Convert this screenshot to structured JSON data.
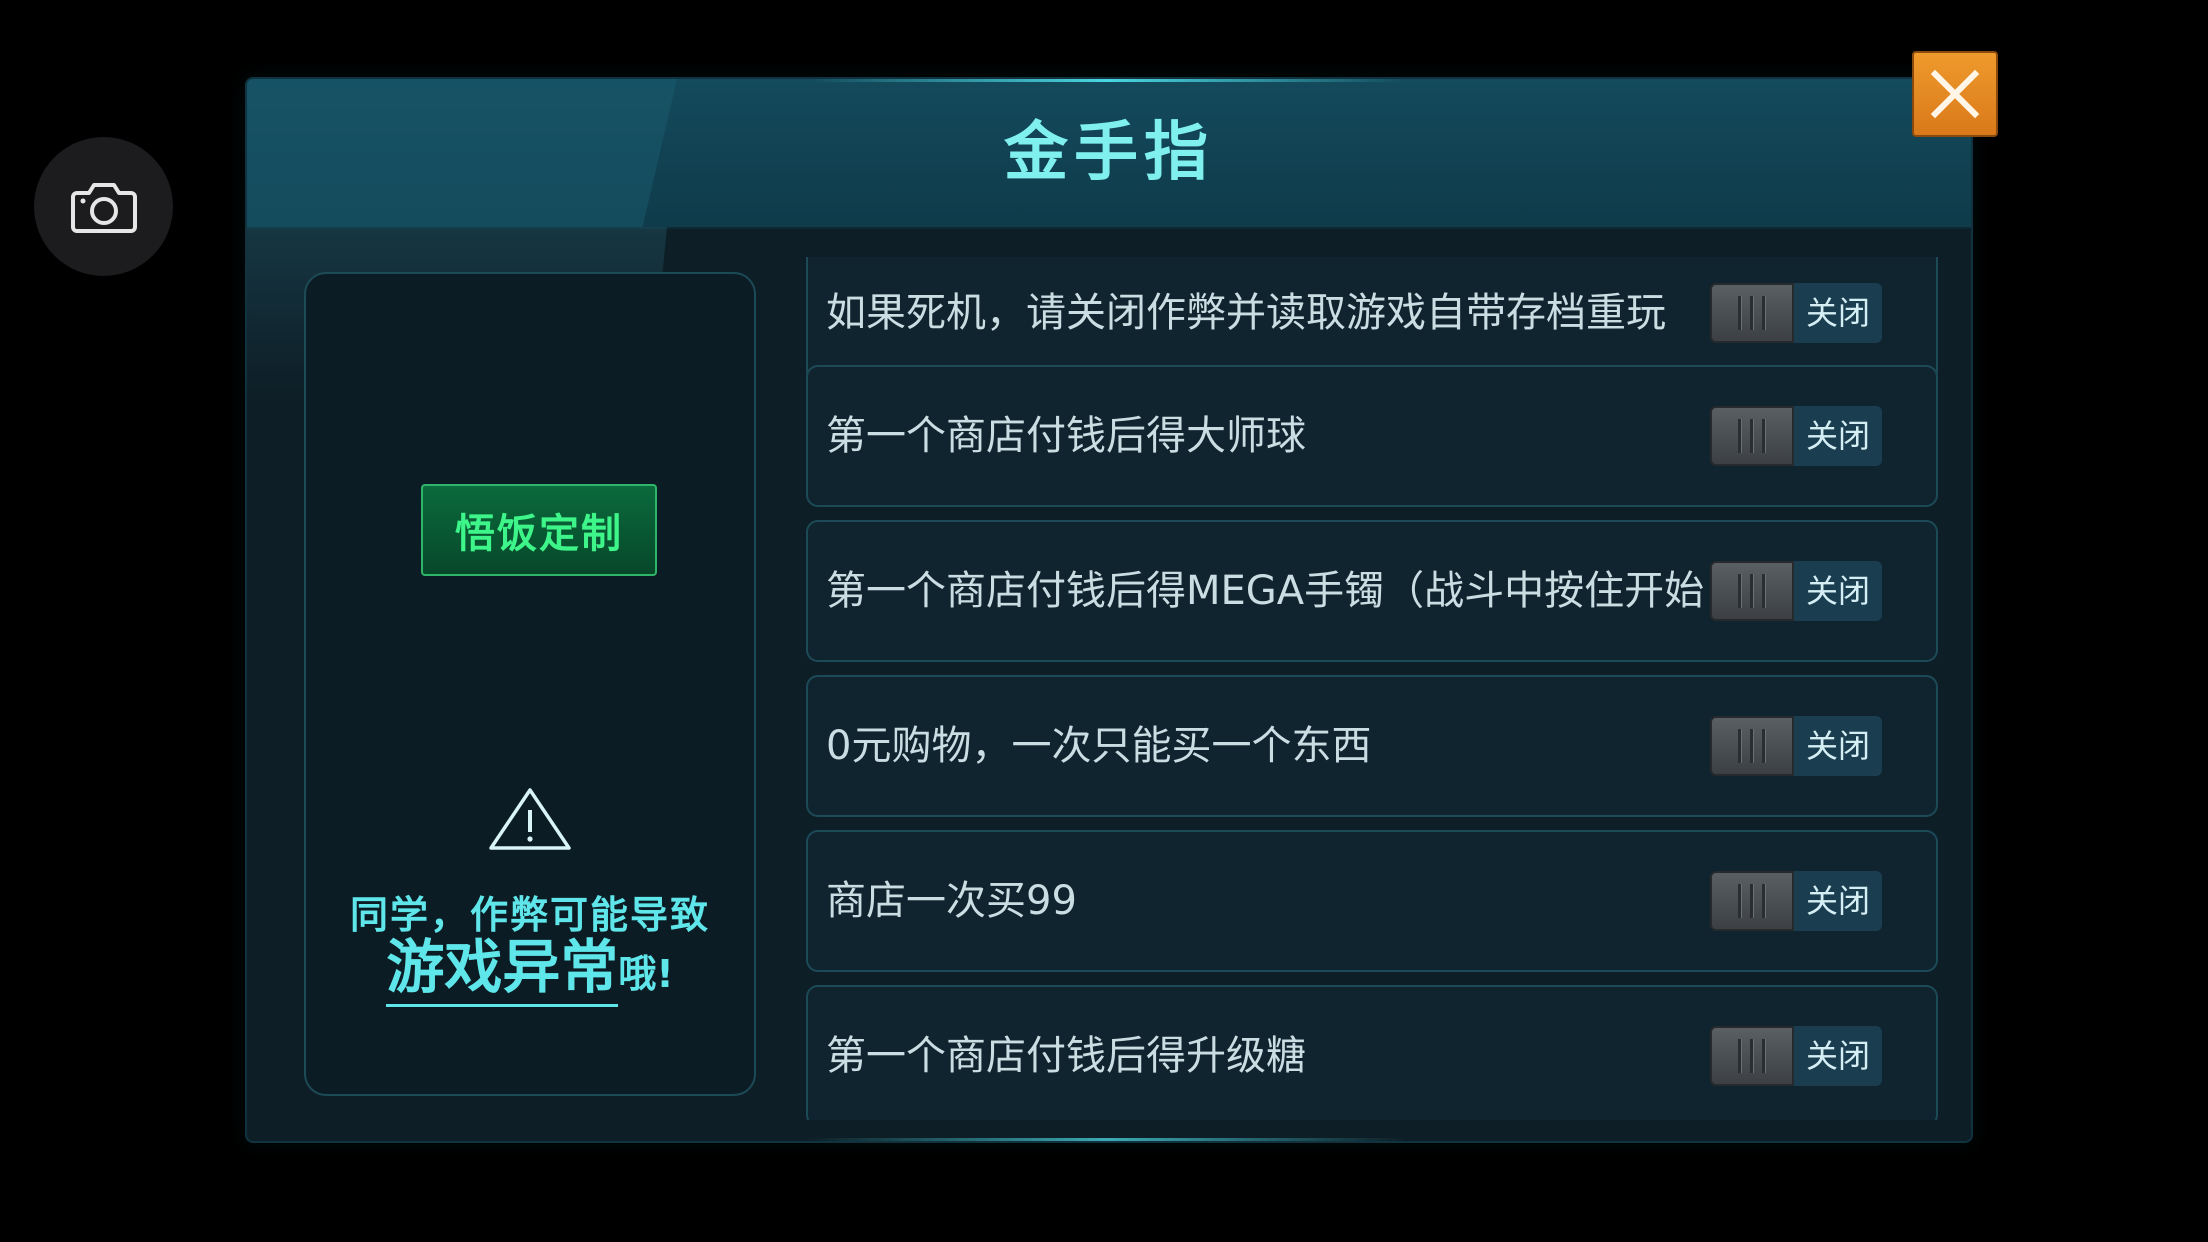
{
  "camera": {
    "icon": "camera-icon"
  },
  "dialog": {
    "title": "金手指",
    "close_icon": "close-icon"
  },
  "left_panel": {
    "custom_button_label": "悟饭定制",
    "warning_icon": "warning-icon",
    "warning_line1": "同学，作弊可能导致",
    "warning_emphasis": "游戏异常",
    "warning_suffix": "哦!"
  },
  "cheats": [
    {
      "label": "如果死机，请关闭作弊并读取游戏自带存档重玩",
      "state": "关闭"
    },
    {
      "label": "第一个商店付钱后得大师球",
      "state": "关闭"
    },
    {
      "label": "第一个商店付钱后得MEGA手镯（战斗中按住开始",
      "state": "关闭"
    },
    {
      "label": "0元购物，一次只能买一个东西",
      "state": "关闭"
    },
    {
      "label": "商店一次买99",
      "state": "关闭"
    },
    {
      "label": "第一个商店付钱后得升级糖",
      "state": "关闭"
    }
  ],
  "colors": {
    "title": "#7ff0ee",
    "accent_cyan": "#5fe6ea",
    "custom_button_text": "#3ef58a",
    "close_button": "#e88a22"
  }
}
